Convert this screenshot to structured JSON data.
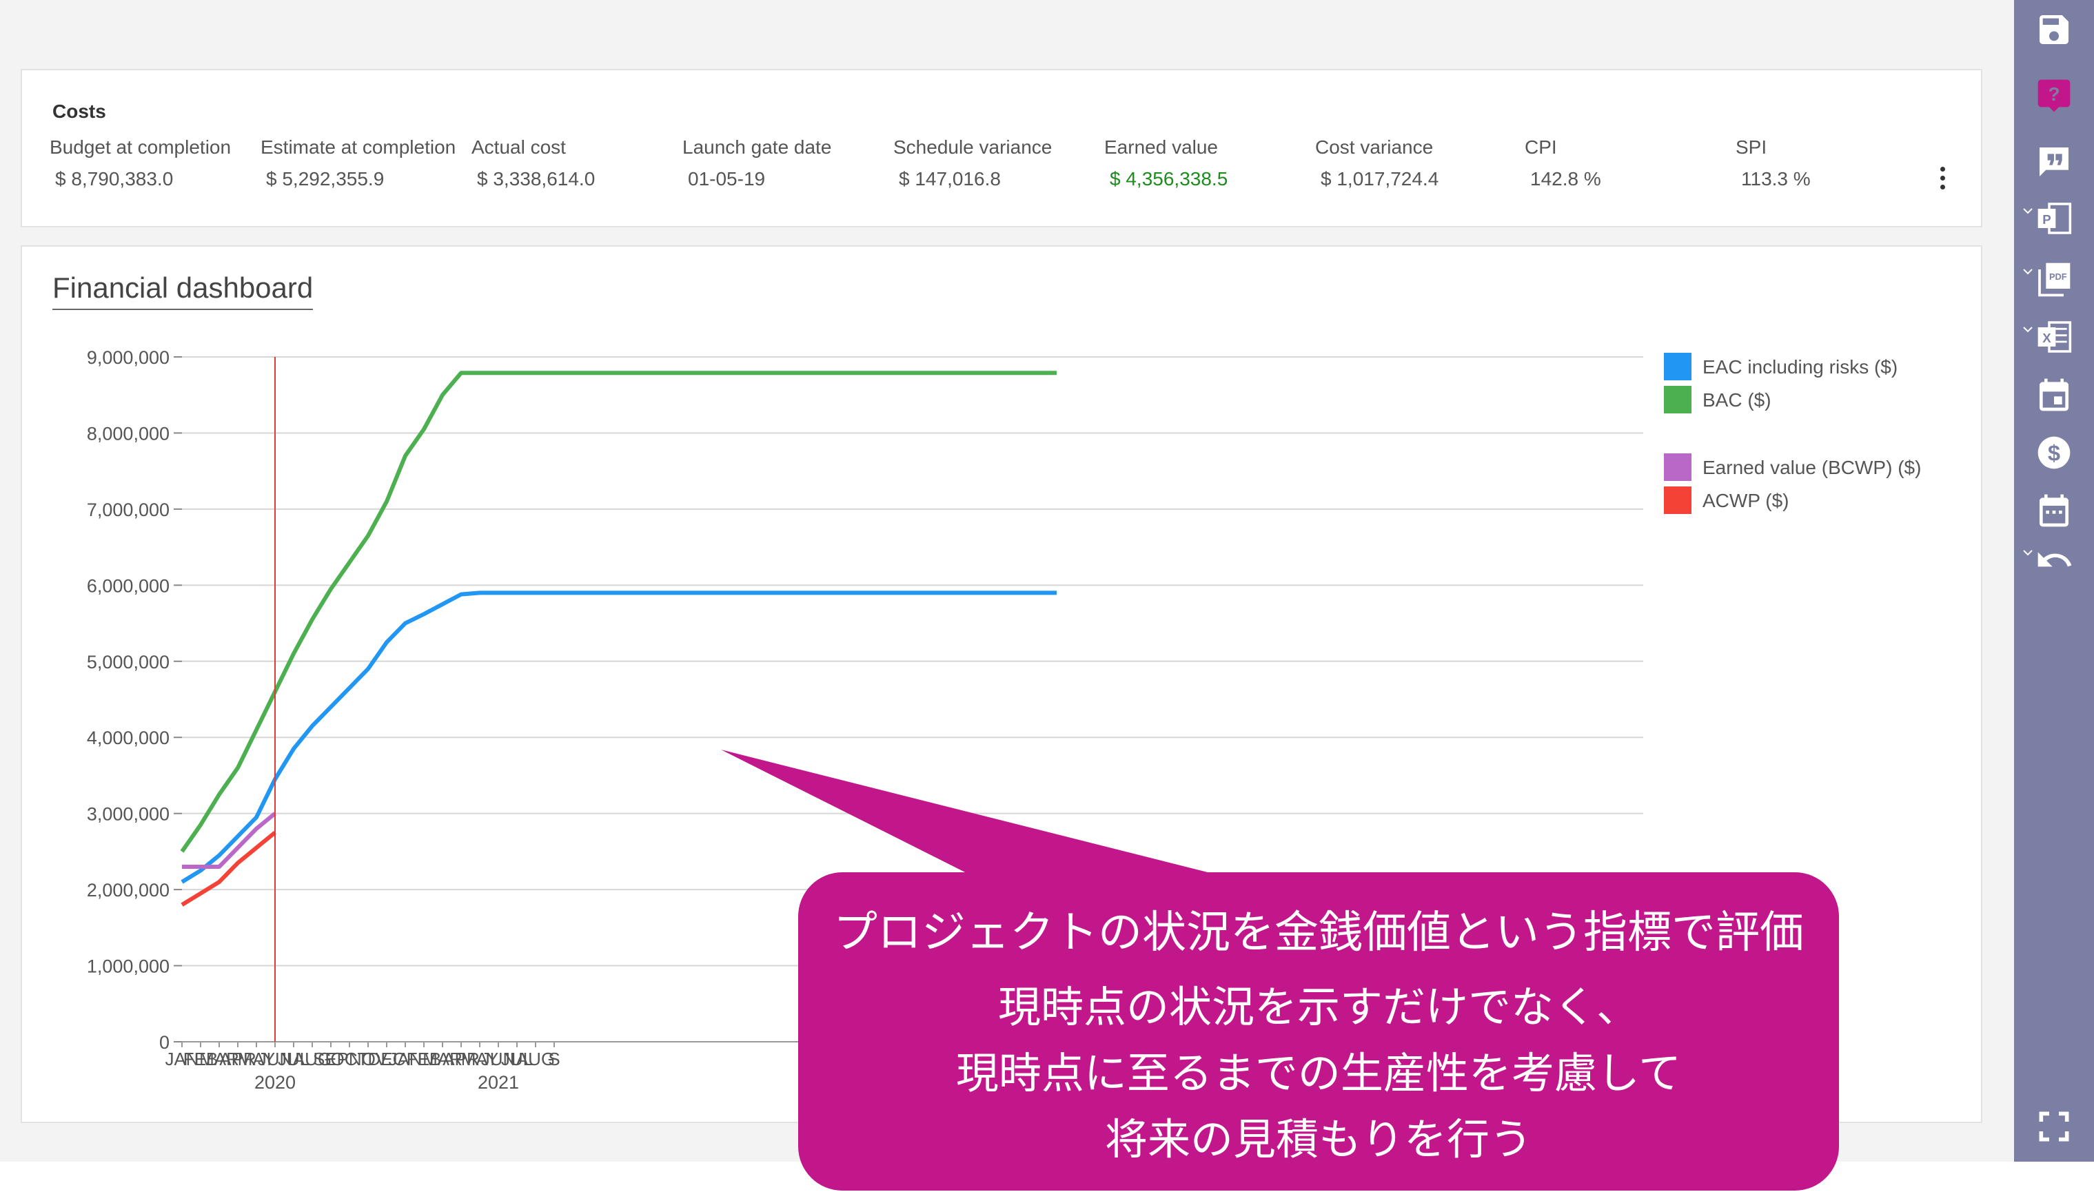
{
  "costs": {
    "title": "Costs",
    "metrics": [
      {
        "label": "Budget at completion",
        "value": "$ 8,790,383.0",
        "highlight": false
      },
      {
        "label": "Estimate at completion",
        "value": "$ 5,292,355.9",
        "highlight": false
      },
      {
        "label": "Actual cost",
        "value": "$ 3,338,614.0",
        "highlight": false
      },
      {
        "label": "Launch gate date",
        "value": "01-05-19",
        "highlight": false
      },
      {
        "label": "Schedule variance",
        "value": "$ 147,016.8",
        "highlight": false
      },
      {
        "label": "Earned value",
        "value": "$ 4,356,338.5",
        "highlight": true
      },
      {
        "label": "Cost variance",
        "value": "$ 1,017,724.4",
        "highlight": false
      },
      {
        "label": "CPI",
        "value": "142.8 %",
        "highlight": false
      },
      {
        "label": "SPI",
        "value": "113.3 %",
        "highlight": false
      }
    ],
    "menu_icon": "kebab-menu-icon"
  },
  "dashboard": {
    "title": "Financial dashboard"
  },
  "chart_data": {
    "type": "line",
    "x_labels": [
      "JAN",
      "FEB",
      "MAR",
      "APR",
      "MAY",
      "JUN",
      "JUL",
      "AUG",
      "SEP",
      "OCT",
      "NOV",
      "DEC",
      "JAN",
      "FEB",
      "MAR",
      "APR",
      "MAY",
      "JUN",
      "JUL",
      "AUG",
      "S"
    ],
    "year_labels": [
      {
        "label": "2020",
        "index": 5
      },
      {
        "label": "2021",
        "index": 17
      }
    ],
    "y_ticks": [
      0,
      1000000,
      2000000,
      3000000,
      4000000,
      5000000,
      6000000,
      7000000,
      8000000,
      9000000
    ],
    "y_tick_labels": [
      "0",
      "1,000,000",
      "2,000,000",
      "3,000,000",
      "4,000,000",
      "5,000,000",
      "6,000,000",
      "7,000,000",
      "8,000,000",
      "9,000,000"
    ],
    "ylim": [
      0,
      9000000
    ],
    "x_range_months": [
      0,
      47
    ],
    "today_index": 5,
    "grid": true,
    "legend_position": "right",
    "series": [
      {
        "name": "EAC including risks ($)",
        "color": "#2196f3",
        "values": [
          2100000,
          2250000,
          2450000,
          2700000,
          2950000,
          3450000,
          3850000,
          4150000,
          4400000,
          4650000,
          4900000,
          5250000,
          5500000,
          5620000,
          5750000,
          5880000,
          5900000,
          5900000,
          5900000,
          5900000,
          5900000,
          5900000,
          5900000,
          5900000,
          5900000,
          5900000,
          5900000,
          5900000,
          5900000,
          5900000,
          5900000,
          5900000,
          5900000,
          5900000,
          5900000,
          5900000,
          5900000,
          5900000,
          5900000,
          5900000,
          5900000,
          5900000,
          5900000,
          5900000,
          5900000,
          5900000,
          5900000,
          5900000
        ]
      },
      {
        "name": "BAC ($)",
        "color": "#4caf50",
        "values": [
          2500000,
          2850000,
          3250000,
          3600000,
          4100000,
          4600000,
          5100000,
          5550000,
          5950000,
          6300000,
          6650000,
          7100000,
          7700000,
          8050000,
          8500000,
          8790000,
          8790000,
          8790000,
          8790000,
          8790000,
          8790000,
          8790000,
          8790000,
          8790000,
          8790000,
          8790000,
          8790000,
          8790000,
          8790000,
          8790000,
          8790000,
          8790000,
          8790000,
          8790000,
          8790000,
          8790000,
          8790000,
          8790000,
          8790000,
          8790000,
          8790000,
          8790000,
          8790000,
          8790000,
          8790000,
          8790000,
          8790000,
          8790000
        ]
      },
      {
        "name": "Earned value (BCWP) ($)",
        "color": "#ba68c8",
        "values": [
          2300000,
          2300000,
          2300000,
          2550000,
          2800000,
          3000000
        ]
      },
      {
        "name": "ACWP ($)",
        "color": "#f44336",
        "values": [
          1800000,
          1950000,
          2100000,
          2350000,
          2550000,
          2750000
        ]
      }
    ]
  },
  "toolbar": {
    "buttons": [
      "save-icon",
      "help-icon",
      "comment-icon",
      "export-powerpoint-icon",
      "export-pdf-icon",
      "export-excel-icon",
      "calendar-icon",
      "cost-icon",
      "schedule-icon",
      "undo-icon",
      "fullscreen-icon"
    ]
  },
  "callout": {
    "headline": "プロジェクトの状況を金銭価値という指標で評価",
    "lines": [
      "現時点の状況を示すだけでなく、",
      "現時点に至るまでの生産性を考慮して",
      "将来の見積もりを行う"
    ],
    "color": "#c2168b"
  }
}
